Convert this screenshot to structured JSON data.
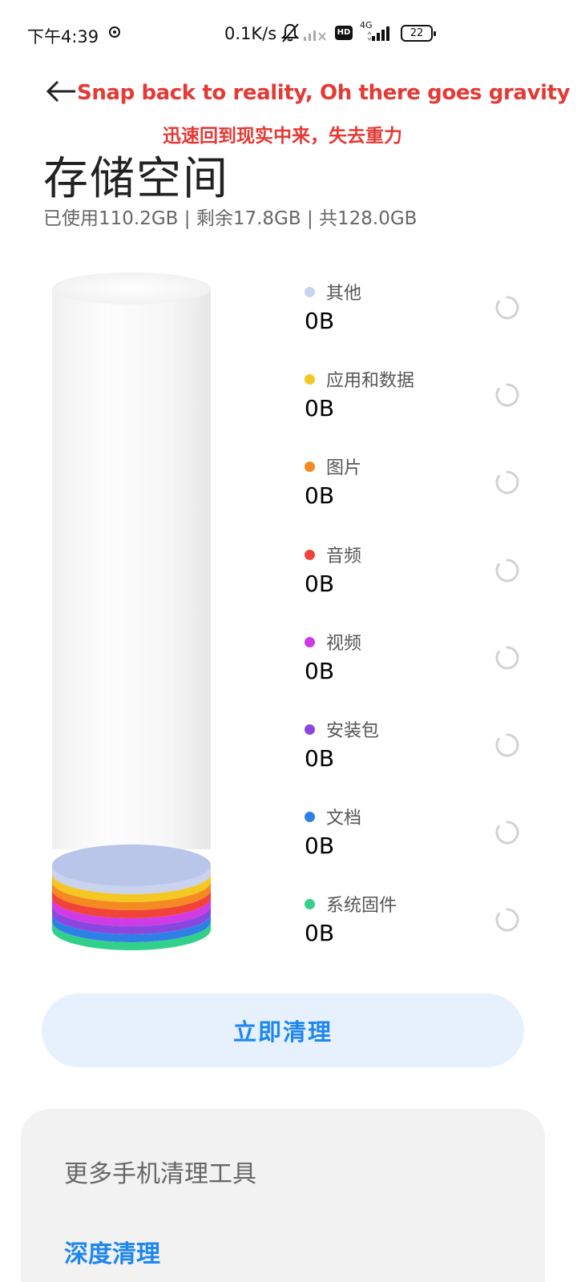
{
  "status_bar": {
    "time": "下午4:39",
    "net_speed": "0.1K/s",
    "hd_label": "HD",
    "network_label": "4G",
    "battery": "22",
    "icons": [
      "app-notification-icon",
      "bell-muted-icon",
      "signal-x-icon",
      "hd-icon",
      "signal-4g-icon",
      "battery-icon"
    ]
  },
  "header": {
    "back_icon": "arrow-left-icon",
    "annotation_en": "Snap back to reality, Oh there goes gravity",
    "annotation_cn": "迅速回到现实中来，失去重力",
    "title": "存储空间",
    "summary": "已使用110.2GB | 剩余17.8GB | 共128.0GB"
  },
  "categories": [
    {
      "label": "其他",
      "value": "0B",
      "color": "#c9d3ee"
    },
    {
      "label": "应用和数据",
      "value": "0B",
      "color": "#f5c723"
    },
    {
      "label": "图片",
      "value": "0B",
      "color": "#f58a22"
    },
    {
      "label": "音频",
      "value": "0B",
      "color": "#f2433a"
    },
    {
      "label": "视频",
      "value": "0B",
      "color": "#cf3be6"
    },
    {
      "label": "安装包",
      "value": "0B",
      "color": "#8a47e0"
    },
    {
      "label": "文档",
      "value": "0B",
      "color": "#2f80e6"
    },
    {
      "label": "系统固件",
      "value": "0B",
      "color": "#32d08a"
    }
  ],
  "spinner_icon": "loading-spinner-icon",
  "actions": {
    "clean_now": "立即清理"
  },
  "tools_card": {
    "title": "更多手机清理工具",
    "deep_clean": "深度清理"
  }
}
